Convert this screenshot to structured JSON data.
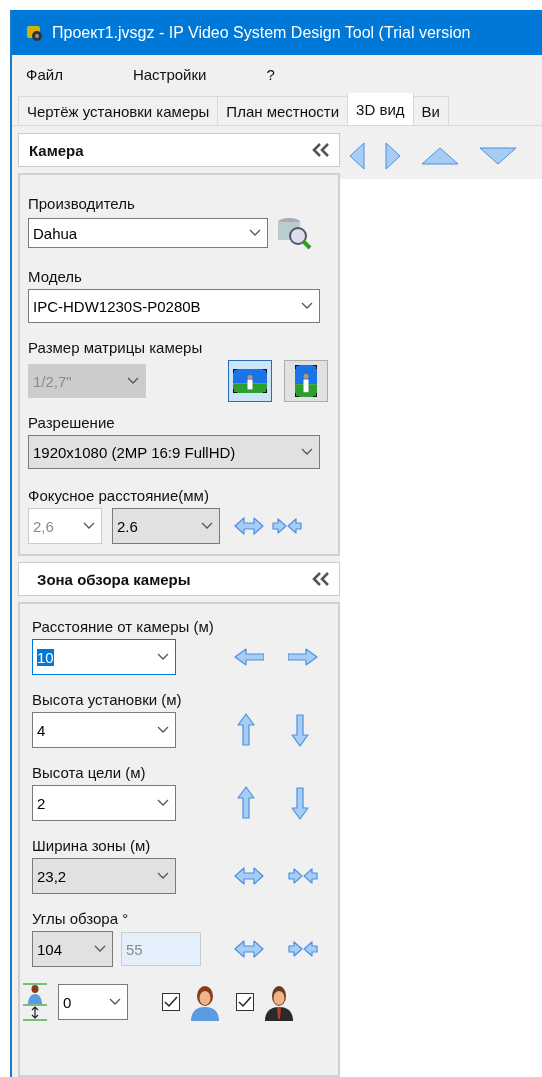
{
  "window": {
    "title": "Проект1.jvsgz - IP Video System Design Tool (Trial version"
  },
  "menu": [
    {
      "label": "Файл"
    },
    {
      "label": "Настройки"
    },
    {
      "label": "?"
    }
  ],
  "tabs": [
    {
      "label": "Чертёж установки камеры",
      "selected": false
    },
    {
      "label": "План местности",
      "selected": false
    },
    {
      "label": "3D вид",
      "selected": true
    },
    {
      "label": "Ви",
      "selected": false
    }
  ],
  "camera_panel": {
    "title": "Камера",
    "manufacturer": {
      "label": "Производитель",
      "value": "Dahua"
    },
    "model": {
      "label": "Модель",
      "value": "IPC-HDW1230S-P0280B"
    },
    "sensor_size": {
      "label": "Размер матрицы камеры",
      "value": "1/2,7\"",
      "disabled": true
    },
    "orientation": [
      {
        "kind": "landscape",
        "selected": true
      },
      {
        "kind": "portrait",
        "selected": false
      }
    ],
    "resolution": {
      "label": "Разрешение",
      "value": "1920x1080 (2MP 16:9 FullHD)",
      "readonly": true
    },
    "focal_length": {
      "label": "Фокусное расстояние(мм)",
      "min": {
        "value": "2,6",
        "disabled": true
      },
      "max": {
        "value": "2.6",
        "readonly": true
      }
    }
  },
  "view_panel": {
    "title": "Зона обзора камеры",
    "rows": [
      {
        "label": "Расстояние от камеры (м)",
        "value": "10",
        "focused": true,
        "readonly": false,
        "kind": "horizontal"
      },
      {
        "label": "Высота установки (м)",
        "value": "4",
        "focused": false,
        "readonly": false,
        "kind": "vertical"
      },
      {
        "label": "Высота цели (м)",
        "value": "2",
        "focused": false,
        "readonly": false,
        "kind": "vertical"
      },
      {
        "label": "Ширина зоны (м)",
        "value": "23,2",
        "focused": false,
        "readonly": true,
        "kind": "zoom"
      }
    ],
    "angles": {
      "label": "Углы обзора °",
      "horizontal": "104",
      "vertical": "55"
    },
    "height_offset": {
      "value": "0"
    },
    "figures": [
      {
        "kind": "woman",
        "checked": true
      },
      {
        "kind": "man",
        "checked": true
      }
    ]
  }
}
